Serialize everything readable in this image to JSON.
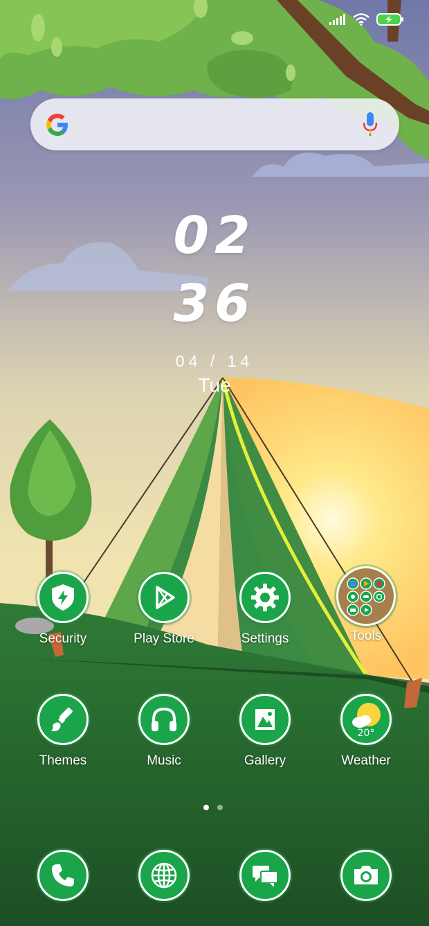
{
  "clock": {
    "hours": "02",
    "minutes": "36",
    "date": "04 / 14",
    "day": "Tue"
  },
  "apps_row1": [
    {
      "label": "Security",
      "icon": "shield-bolt-icon"
    },
    {
      "label": "Play Store",
      "icon": "play-icon"
    },
    {
      "label": "Settings",
      "icon": "gear-icon"
    },
    {
      "label": "Tools",
      "icon": "folder-icon"
    }
  ],
  "apps_row2": [
    {
      "label": "Themes",
      "icon": "brush-icon"
    },
    {
      "label": "Music",
      "icon": "headphones-icon"
    },
    {
      "label": "Gallery",
      "icon": "image-icon"
    },
    {
      "label": "Weather",
      "icon": "sun-cloud-icon",
      "temp": "20°"
    }
  ],
  "dock": [
    {
      "icon": "phone-icon"
    },
    {
      "icon": "globe-icon"
    },
    {
      "icon": "chat-icon"
    },
    {
      "icon": "camera-icon"
    }
  ],
  "pages": {
    "count": 2,
    "current": 1
  },
  "colors": {
    "icon_green": "#1aa54b",
    "grass": "#2b6e34",
    "text": "#ffffff"
  }
}
